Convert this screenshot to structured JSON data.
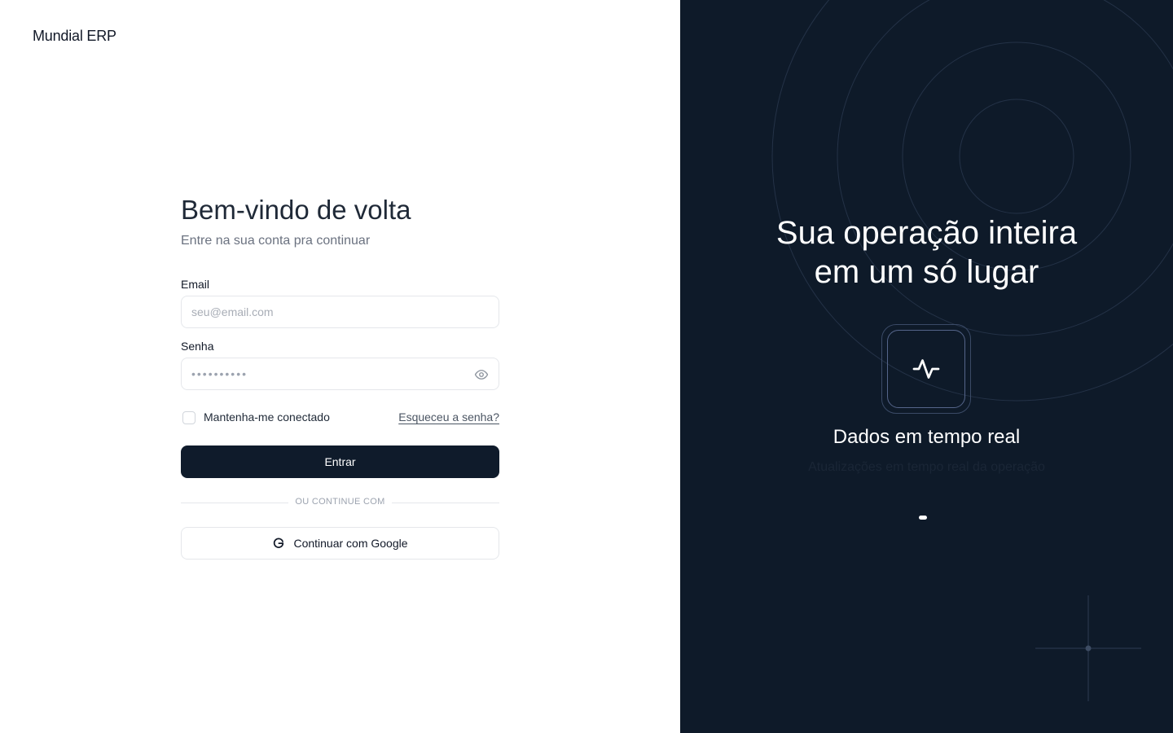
{
  "brand": {
    "name": "Mundial ERP"
  },
  "login": {
    "title": "Bem-vindo de volta",
    "subtitle": "Entre na sua conta pra continuar",
    "email_label": "Email",
    "email_placeholder": "seu@email.com",
    "password_label": "Senha",
    "password_value": "••••••••••",
    "remember_label": "Mantenha-me conectado",
    "remember_checked": false,
    "forgot_label": "Esqueceu a senha?",
    "submit_label": "Entrar",
    "divider_label": "OU CONTINUE COM",
    "google_label": "Continuar com Google"
  },
  "showcase": {
    "headline_line1": "Sua operação inteira",
    "headline_line2": "em um só lugar",
    "feature_icon": "activity-pulse-icon",
    "feature_title": "Dados em tempo real",
    "feature_subtitle": "Atualizações em tempo real da operação",
    "carousel_active_index": 0,
    "carousel_count": 1
  },
  "colors": {
    "dark_panel": "#0e1a29",
    "primary_button": "#0f1b2b",
    "border": "#e5e7eb",
    "muted_text": "#6b7280"
  }
}
